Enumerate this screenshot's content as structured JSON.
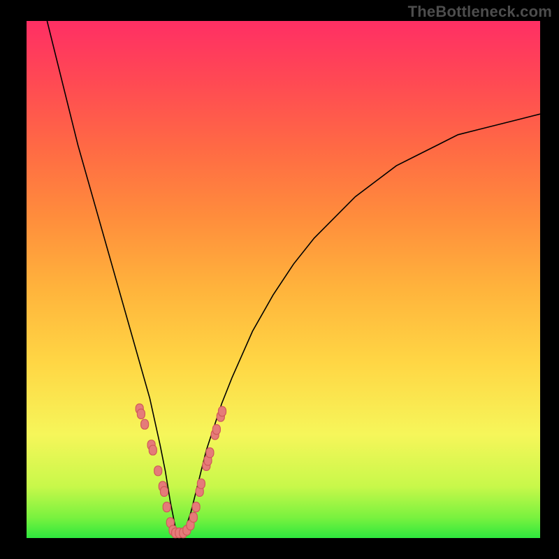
{
  "watermark": "TheBottleneck.com",
  "colors": {
    "frame": "#000000",
    "gradient_top": "#ff2f64",
    "gradient_bottom": "#2ee83e",
    "curve": "#000000",
    "dot_fill": "#e57b79",
    "dot_stroke": "#cf5a5a"
  },
  "chart_data": {
    "type": "line",
    "title": "",
    "xlabel": "",
    "ylabel": "",
    "xlim": [
      0,
      100
    ],
    "ylim": [
      0,
      100
    ],
    "note": "Smooth V-shaped curve with minimum around x≈29. Background heat-map gradient from green (bottom, y≈0) to red (top, y≈100). Pink dots cluster on both branches near the bottom (y roughly 0–25).",
    "series": [
      {
        "name": "curve",
        "x": [
          4,
          6,
          8,
          10,
          12,
          14,
          16,
          18,
          20,
          22,
          24,
          26,
          27,
          28,
          29,
          30,
          31,
          32,
          33,
          34,
          35,
          36,
          38,
          40,
          44,
          48,
          52,
          56,
          60,
          64,
          68,
          72,
          76,
          80,
          84,
          88,
          92,
          96,
          100
        ],
        "y": [
          100,
          92,
          84,
          76,
          69,
          62,
          55,
          48,
          41,
          34,
          27,
          18,
          13,
          7,
          2,
          0,
          2,
          5,
          9,
          13,
          17,
          20,
          26,
          31,
          40,
          47,
          53,
          58,
          62,
          66,
          69,
          72,
          74,
          76,
          78,
          79,
          80,
          81,
          82
        ]
      }
    ],
    "dots": [
      {
        "x": 22.0,
        "y": 25
      },
      {
        "x": 22.3,
        "y": 24
      },
      {
        "x": 23.0,
        "y": 22
      },
      {
        "x": 24.3,
        "y": 18
      },
      {
        "x": 24.6,
        "y": 17
      },
      {
        "x": 25.6,
        "y": 13
      },
      {
        "x": 26.5,
        "y": 10
      },
      {
        "x": 26.8,
        "y": 9
      },
      {
        "x": 27.3,
        "y": 6
      },
      {
        "x": 28.0,
        "y": 3
      },
      {
        "x": 28.5,
        "y": 1.5
      },
      {
        "x": 29.0,
        "y": 1
      },
      {
        "x": 29.7,
        "y": 1
      },
      {
        "x": 30.5,
        "y": 1
      },
      {
        "x": 31.2,
        "y": 1.5
      },
      {
        "x": 31.9,
        "y": 2.5
      },
      {
        "x": 32.5,
        "y": 4
      },
      {
        "x": 33.0,
        "y": 6
      },
      {
        "x": 33.7,
        "y": 9
      },
      {
        "x": 34.0,
        "y": 10.5
      },
      {
        "x": 35.0,
        "y": 14
      },
      {
        "x": 35.3,
        "y": 15
      },
      {
        "x": 35.7,
        "y": 16.5
      },
      {
        "x": 36.7,
        "y": 20
      },
      {
        "x": 37.0,
        "y": 21
      },
      {
        "x": 37.8,
        "y": 23.5
      },
      {
        "x": 38.1,
        "y": 24.5
      }
    ]
  }
}
